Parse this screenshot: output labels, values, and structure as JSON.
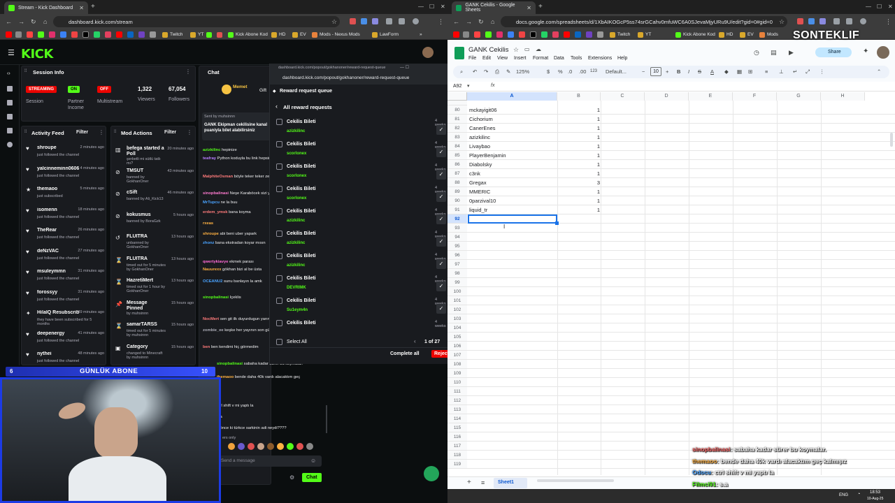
{
  "left_browser": {
    "tab_title": "Stream - Kick Dashboard",
    "url": "dashboard.kick.com/stream",
    "bookmarks": [
      "Twitch",
      "YT",
      "Kick Abone Kod",
      "HD",
      "EV",
      "Mods - Nexus Mods",
      "LawForm"
    ]
  },
  "right_browser": {
    "tab_title": "GANK Cekilis - Google Sheets",
    "url": "docs.google.com/spreadsheets/d/1XbAIKOGcP5ss74srGCahv0mfuWC6A0SJevaMjyURu9U/edit?gid=0#gid=0",
    "bookmarks": [
      "Twitch",
      "YT",
      "Kick Abone Kod",
      "HD",
      "EV",
      "Mods"
    ]
  },
  "kick": {
    "logo": "KICK",
    "session_info": {
      "title": "Session Info",
      "streaming_badge": "STREAMING",
      "on_badge": "ON",
      "off_badge": "OFF",
      "session_label": "Session",
      "partner_label": "Partner Income",
      "multistream_label": "Multistream",
      "viewers_value": "1,322",
      "viewers_label": "Viewers",
      "followers_value": "67,054",
      "followers_label": "Followers"
    },
    "activity_feed": {
      "title": "Activity Feed",
      "filter": "Filter",
      "items": [
        {
          "name": "shroupe",
          "sub": "just followed the channel",
          "time": "2 minutes ago"
        },
        {
          "name": "yalcinneminn0606",
          "sub": "just followed the channel",
          "time": "4 minutes ago"
        },
        {
          "name": "themaoo",
          "sub": "just subscribed",
          "time": "5 minutes ago"
        },
        {
          "name": "isomenn",
          "sub": "just followed the channel",
          "time": "18 minutes ago"
        },
        {
          "name": "TheRear",
          "sub": "just followed the channel",
          "time": "26 minutes ago"
        },
        {
          "name": "deNzVAC",
          "sub": "just followed the channel",
          "time": "27 minutes ago"
        },
        {
          "name": "msuleymmn",
          "sub": "just followed the channel",
          "time": "31 minutes ago"
        },
        {
          "name": "forossyy",
          "sub": "just followed the channel",
          "time": "31 minutes ago"
        },
        {
          "name": "HilalQ Resubscribed!",
          "sub": "they have been subscribed for 5 months",
          "time": "39 minutes ago"
        },
        {
          "name": "deepenergy",
          "sub": "just followed the channel",
          "time": "41 minutes ago"
        },
        {
          "name": "nythei",
          "sub": "just followed the channel",
          "time": "48 minutes ago"
        }
      ]
    },
    "mod_actions": {
      "title": "Mod Actions",
      "filter": "Filter",
      "items": [
        {
          "name": "befega started a Poll",
          "sub": "şerbetli mi sütlü tatlı mı?",
          "time": "20 minutes ago"
        },
        {
          "name": "TMSUT",
          "sub": "banned by GokhanOner",
          "time": "43 minutes ago"
        },
        {
          "name": "cSift",
          "sub": "banned by Ali_Kick13",
          "time": "46 minutes ago"
        },
        {
          "name": "kokusmus",
          "sub": "banned by BoraGzk",
          "time": "5 hours ago"
        },
        {
          "name": "FLUITRA",
          "sub": "unbanned by GokhanOner",
          "time": "13 hours ago"
        },
        {
          "name": "FLUITRA",
          "sub": "timed out for 5 minutes by GokhanOner",
          "time": "13 hours ago"
        },
        {
          "name": "HazretiMert",
          "sub": "timed out for 1 hour by GokhanOner",
          "time": "13 hours ago"
        },
        {
          "name": "Message Pinned",
          "sub": "by muhsinnn",
          "time": "15 hours ago"
        },
        {
          "name": "samarTARSS",
          "sub": "timed out for 5 minutes by muhsinnn",
          "time": "15 hours ago"
        },
        {
          "name": "Category",
          "sub": "changed to Minecraft by muhsinnn",
          "time": "15 hours ago"
        }
      ]
    },
    "chat": {
      "title": "Chat",
      "pinned_user": "Memet",
      "pinned_text": "Gift",
      "pinned_banner": "GANK Ekipman cekilisine kanal puaniyla bilet alabilirsiniz",
      "sent_by": "Sent by muhsinnn",
      "lines": [
        {
          "user": "azizkilinc",
          "text": "hepinize"
        },
        {
          "user": "teafray",
          "text": "Python koduyla bu link hepsini alarak toplar eklerdin e ugrasmazdin boyle"
        },
        {
          "user": "MalphiteOsman",
          "text": "böyle teker teker zekaya yaptırabilirsin"
        },
        {
          "user": "sinopbalinasi",
          "text": "Neşe Karaböcek sizi yolumuzdan bir daha koydum."
        },
        {
          "user": "MrTupcu",
          "text": "ne la buu"
        },
        {
          "user": "erdem_ymsk",
          "text": "bana koyma"
        },
        {
          "user": "rxeas",
          "text": ""
        },
        {
          "user": "shroupe",
          "text": "abi beni uber yapark"
        },
        {
          "user": "zhonz",
          "text": "bana ekstradan koyar mısın"
        },
        {
          "user": "qwertykiavye",
          "text": "ekmek parası"
        },
        {
          "user": "Nauurexx",
          "text": "gökhan bizi al be üsta"
        },
        {
          "user": "OCEANU2",
          "text": "sunu banlayın la amk"
        },
        {
          "user": "sinopbalinasi",
          "text": "İçeklis"
        },
        {
          "user": "NocMert",
          "text": "sen git ilk duyurdugun yarında hemen 5k puan yap son"
        },
        {
          "user": "zombie_ee",
          "text": "keşke her yayının son gününe kalmasaydı"
        },
        {
          "user": "ben",
          "text": "ben kendimi hiç görmedim"
        },
        {
          "user": "sinopbalinasi",
          "text": "sabaha kadar sürer bu koymalar."
        },
        {
          "user": "themaoo",
          "text": "bende daha 40k vardı alacaktım geç"
        },
        {
          "user": "",
          "text": "ctrl shift v mi yaptı la"
        },
        {
          "user": "",
          "text": "s.a"
        },
        {
          "user": "",
          "text": "z önce ki türkce sarkinin adi neydi????"
        }
      ],
      "followers_only": "ers only",
      "send_placeholder": "Send a message",
      "send_button": "Chat"
    },
    "popup": {
      "url": "dashboard.kick.com/popout/gokhanoner/reward-request-queue",
      "window_title": "Reward request queue",
      "back": "All reward requests",
      "requests": [
        {
          "title": "Cekilis Bileti",
          "user": "azizkilinc",
          "time": "4 weeks"
        },
        {
          "title": "Cekilis Bileti",
          "user": "scorlonex",
          "time": "4 weeks"
        },
        {
          "title": "Cekilis Bileti",
          "user": "scorlonex",
          "time": "4 weeks"
        },
        {
          "title": "Cekilis Bileti",
          "user": "scorlonex",
          "time": "4 weeks"
        },
        {
          "title": "Cekilis Bileti",
          "user": "azizkilinc",
          "time": "4 weeks"
        },
        {
          "title": "Cekilis Bileti",
          "user": "azizkilinc",
          "time": "4 weeks"
        },
        {
          "title": "Cekilis Bileti",
          "user": "azizkilinc",
          "time": "4 weeks"
        },
        {
          "title": "Cekilis Bileti",
          "user": "DEVRIMK",
          "time": "4 weeks"
        },
        {
          "title": "Cekilis Bileti",
          "user": "Su1eym4n",
          "time": "4 weeks"
        },
        {
          "title": "Cekilis Bileti",
          "user": "",
          "time": "4 weeks"
        }
      ],
      "select_all": "Select All",
      "pagination": "1 of 27",
      "complete_all": "Complete all",
      "reject": "Reject"
    }
  },
  "overlay": {
    "abone_left": "6",
    "abone_label": "GÜNLÜK ABONE",
    "abone_right": "10"
  },
  "sheets": {
    "doc_title": "GANK Cekilis",
    "menu": [
      "File",
      "Edit",
      "View",
      "Insert",
      "Format",
      "Data",
      "Tools",
      "Extensions",
      "Help"
    ],
    "zoom": "125%",
    "font": "Default...",
    "font_size": "10",
    "name_box": "A92",
    "share": "Share",
    "columns": [
      "A",
      "B",
      "C",
      "D",
      "E",
      "F",
      "G",
      "H"
    ],
    "rows": [
      {
        "num": "80",
        "a": "mckayigit06",
        "b": "1"
      },
      {
        "num": "81",
        "a": "Cichorium",
        "b": "1"
      },
      {
        "num": "82",
        "a": "CanerEnes",
        "b": "1"
      },
      {
        "num": "83",
        "a": "azizkilinc",
        "b": "1"
      },
      {
        "num": "84",
        "a": "Livaybao",
        "b": "1"
      },
      {
        "num": "85",
        "a": "PlayerBenjamin",
        "b": "1"
      },
      {
        "num": "86",
        "a": "Diabolsky",
        "b": "1"
      },
      {
        "num": "87",
        "a": "c3nk",
        "b": "1"
      },
      {
        "num": "88",
        "a": "Gregax",
        "b": "3"
      },
      {
        "num": "89",
        "a": "MMERIC",
        "b": "1"
      },
      {
        "num": "90",
        "a": "0parzival10",
        "b": "1"
      },
      {
        "num": "91",
        "a": "liquid_tr",
        "b": "1"
      },
      {
        "num": "92",
        "a": "",
        "b": ""
      },
      {
        "num": "93",
        "a": "",
        "b": ""
      },
      {
        "num": "94",
        "a": "",
        "b": ""
      },
      {
        "num": "95",
        "a": "",
        "b": ""
      },
      {
        "num": "96",
        "a": "",
        "b": ""
      },
      {
        "num": "97",
        "a": "",
        "b": ""
      },
      {
        "num": "98",
        "a": "",
        "b": ""
      },
      {
        "num": "99",
        "a": "",
        "b": ""
      },
      {
        "num": "100",
        "a": "",
        "b": ""
      },
      {
        "num": "101",
        "a": "",
        "b": ""
      },
      {
        "num": "102",
        "a": "",
        "b": ""
      },
      {
        "num": "103",
        "a": "",
        "b": ""
      },
      {
        "num": "104",
        "a": "",
        "b": ""
      },
      {
        "num": "105",
        "a": "",
        "b": ""
      },
      {
        "num": "106",
        "a": "",
        "b": ""
      },
      {
        "num": "107",
        "a": "",
        "b": ""
      },
      {
        "num": "108",
        "a": "",
        "b": ""
      },
      {
        "num": "109",
        "a": "",
        "b": ""
      },
      {
        "num": "110",
        "a": "",
        "b": ""
      },
      {
        "num": "111",
        "a": "",
        "b": ""
      },
      {
        "num": "112",
        "a": "",
        "b": ""
      },
      {
        "num": "113",
        "a": "",
        "b": ""
      },
      {
        "num": "114",
        "a": "",
        "b": ""
      },
      {
        "num": "115",
        "a": "",
        "b": ""
      },
      {
        "num": "116",
        "a": "",
        "b": ""
      },
      {
        "num": "117",
        "a": "",
        "b": ""
      },
      {
        "num": "118",
        "a": "",
        "b": ""
      },
      {
        "num": "119",
        "a": "",
        "b": ""
      }
    ],
    "sheet_tab": "Sheet1"
  },
  "stream_overlay": {
    "watermark": "SONTEKLIF",
    "chat": [
      {
        "user": "sinopbalinasi",
        "text": ": sabaha kadar sürer bu koymalar.",
        "color": "#ff6b6b"
      },
      {
        "user": "themaoo",
        "text": ": bende daha 40k vardı alacaktım geç kalmışız",
        "color": "#ffb142"
      },
      {
        "user": "Odocu",
        "text": ": ctrl shift v mi yaptı la",
        "color": "#4aa3ff"
      },
      {
        "user": "Filmci91",
        "text": ": s.a",
        "color": "#53fc18"
      },
      {
        "user": "9can",
        "text": ": az önce ki türkce sarkinin adi neydi????",
        "color": "#ff4d4d"
      }
    ],
    "clock_time": "18:53",
    "clock_date": "10-Aug-25",
    "lang": "ENG"
  },
  "colors": {
    "kick_green": "#53fc18",
    "streaming_red": "#eb0400",
    "sheets_green": "#0f9d58",
    "selection_blue": "#1a73e8",
    "overlay_blue": "#1c3be6"
  }
}
